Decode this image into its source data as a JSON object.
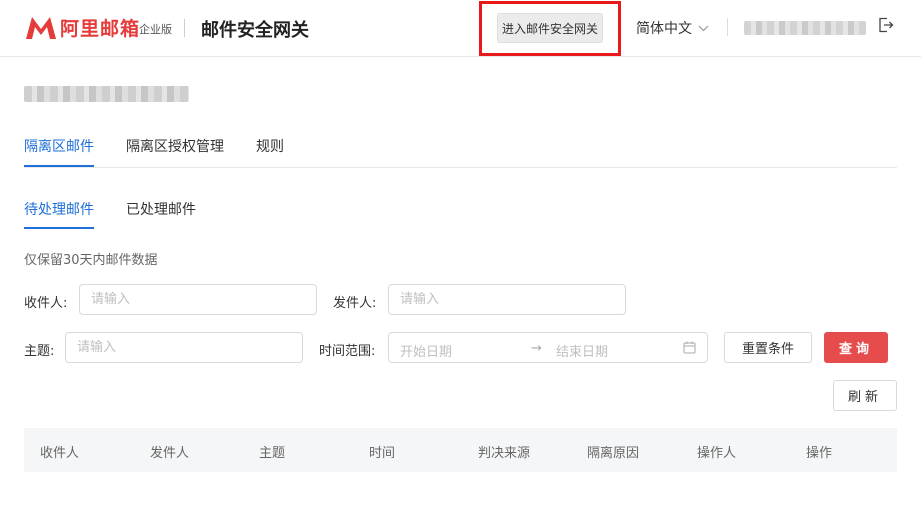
{
  "header": {
    "brand": "阿里邮箱",
    "edition": "企业版",
    "product_title": "邮件安全网关",
    "enter_gateway_button": "进入邮件安全网关",
    "language": "简体中文",
    "brand_color": "#e63b3b"
  },
  "tabs": [
    {
      "label": "隔离区邮件",
      "active": true
    },
    {
      "label": "隔离区授权管理",
      "active": false
    },
    {
      "label": "规则",
      "active": false
    }
  ],
  "subtabs": [
    {
      "label": "待处理邮件",
      "active": true
    },
    {
      "label": "已处理邮件",
      "active": false
    }
  ],
  "note": "仅保留30天内邮件数据",
  "filters": {
    "recipient_label": "收件人:",
    "recipient_placeholder": "请输入",
    "sender_label": "发件人:",
    "sender_placeholder": "请输入",
    "subject_label": "主题:",
    "subject_placeholder": "请输入",
    "time_range_label": "时间范围:",
    "start_date_placeholder": "开始日期",
    "range_separator": "→",
    "end_date_placeholder": "结束日期"
  },
  "buttons": {
    "reset": "重置条件",
    "query": "查询",
    "refresh": "刷新"
  },
  "table": {
    "columns": [
      "收件人",
      "发件人",
      "主题",
      "时间",
      "判决来源",
      "隔离原因",
      "操作人",
      "操作"
    ]
  },
  "colors": {
    "accent_blue": "#1e6fd9",
    "query_red": "#e74c4c",
    "highlight_red": "#e8191b"
  },
  "icons": [
    "logo-m-icon",
    "chevron-down-icon",
    "logout-icon",
    "calendar-icon"
  ]
}
